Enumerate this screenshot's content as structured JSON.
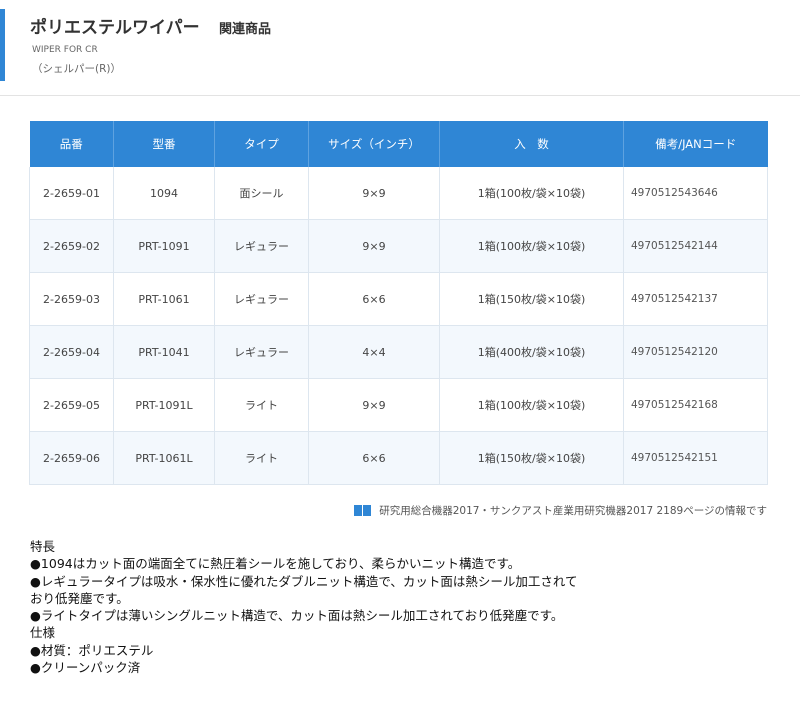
{
  "header": {
    "title": "ポリエステルワイパー",
    "related_label": "関連商品",
    "subtitle_en": "WIPER FOR CR",
    "subtitle_jp": "（シェルパー(R)）",
    "accent_color": "#2f86d5"
  },
  "table": {
    "header_color": "#2f86d5",
    "columns": [
      "品番",
      "型番",
      "タイプ",
      "サイズ（インチ）",
      "入　数",
      "備考/JANコード"
    ],
    "rows": [
      {
        "code": "2-2659-01",
        "model": "1094",
        "type": "面シール",
        "size": "9×9",
        "quantity": "1箱(100枚/袋×10袋)",
        "jan": "4970512543646"
      },
      {
        "code": "2-2659-02",
        "model": "PRT-1091",
        "type": "レギュラー",
        "size": "9×9",
        "quantity": "1箱(100枚/袋×10袋)",
        "jan": "4970512542144"
      },
      {
        "code": "2-2659-03",
        "model": "PRT-1061",
        "type": "レギュラー",
        "size": "6×6",
        "quantity": "1箱(150枚/袋×10袋)",
        "jan": "4970512542137"
      },
      {
        "code": "2-2659-04",
        "model": "PRT-1041",
        "type": "レギュラー",
        "size": "4×4",
        "quantity": "1箱(400枚/袋×10袋)",
        "jan": "4970512542120"
      },
      {
        "code": "2-2659-05",
        "model": "PRT-1091L",
        "type": "ライト",
        "size": "9×9",
        "quantity": "1箱(100枚/袋×10袋)",
        "jan": "4970512542168"
      },
      {
        "code": "2-2659-06",
        "model": "PRT-1061L",
        "type": "ライト",
        "size": "6×6",
        "quantity": "1箱(150枚/袋×10袋)",
        "jan": "4970512542151"
      }
    ]
  },
  "source_note": {
    "icon": "book-icon",
    "text": "研究用総合機器2017・サンクアスト産業用研究機器2017 2189ページの情報です"
  },
  "features": {
    "heading": "特長",
    "items": [
      "●1094はカット面の端面全てに熱圧着シールを施しており、柔らかいニット構造です。",
      "●レギュラータイプは吸水・保水性に優れたダブルニット構造で、カット面は熱シール加工されて",
      "おり低発塵です。",
      "●ライトタイプは薄いシングルニット構造で、カット面は熱シール加工されており低発塵です。"
    ],
    "spec_heading": "仕様",
    "spec_items": [
      "●材質：ポリエステル",
      "●クリーンパック済"
    ]
  }
}
